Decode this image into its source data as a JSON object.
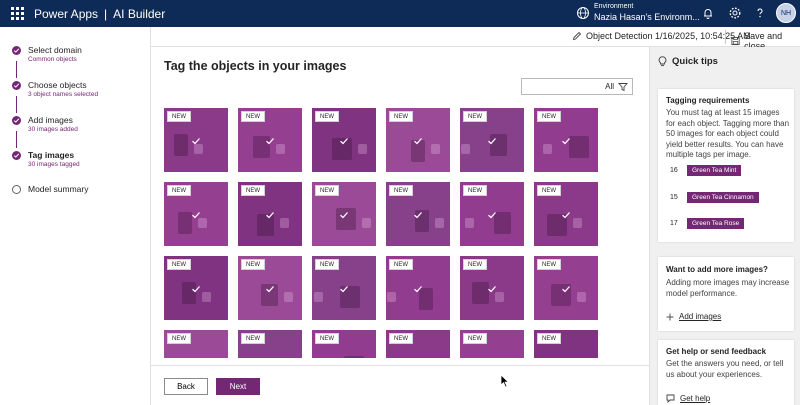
{
  "header": {
    "app_name": "Power Apps",
    "separator": "|",
    "app_section": "AI Builder",
    "environment_label": "Environment",
    "environment_name": "Nazia Hasan's Environm...",
    "avatar_initials": "NH",
    "icons": [
      "waffle-icon",
      "globe-icon",
      "bell-icon",
      "gear-icon",
      "help-icon"
    ]
  },
  "subbar": {
    "draft_name": "Object Detection 1/16/2025, 10:54:25 AM",
    "save_close_label": "Save and close"
  },
  "steps": [
    {
      "title": "Select domain",
      "subtitle": "Common objects",
      "state": "done"
    },
    {
      "title": "Choose objects",
      "subtitle": "3 object names selected",
      "state": "done"
    },
    {
      "title": "Add images",
      "subtitle": "30 images added",
      "state": "done"
    },
    {
      "title": "Tag images",
      "subtitle": "30 images tagged",
      "state": "current"
    },
    {
      "title": "Model summary",
      "subtitle": "",
      "state": "pending"
    }
  ],
  "main": {
    "title": "Tag the objects in your images",
    "filter_value": "All",
    "tile_badge": "NEW",
    "back_label": "Back",
    "next_label": "Next"
  },
  "quick_tips": {
    "header": "Quick tips",
    "tagging": {
      "title": "Tagging requirements",
      "text": "You must tag at least 15 images for each object. Tagging more than 50 images for each object could yield better results. You can have multiple tags per image.",
      "tags": [
        {
          "count": "16",
          "label": "Green Tea Mint"
        },
        {
          "count": "15",
          "label": "Green Tea Cinnamon"
        },
        {
          "count": "17",
          "label": "Green Tea Rose"
        }
      ]
    },
    "more_images": {
      "title": "Want to add more images?",
      "text": "Adding more images may increase model performance.",
      "link": "Add images"
    },
    "help": {
      "title": "Get help or send feedback",
      "text": "Get the answers you need, or tell us about your experiences.",
      "link": "Get help"
    }
  },
  "colors": {
    "header_bg": "#0e2a56",
    "accent": "#742774",
    "tile_overlay": "#8f3f8d"
  }
}
